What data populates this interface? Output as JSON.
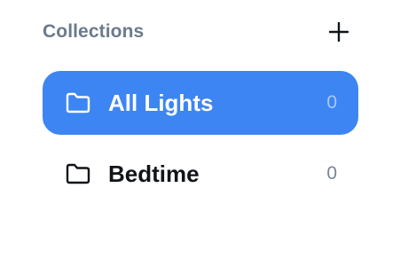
{
  "collections": {
    "title": "Collections",
    "add_icon": "plus-icon",
    "items": [
      {
        "label": "All Lights",
        "count": "0",
        "icon": "folder-icon",
        "active": true
      },
      {
        "label": "Bedtime",
        "count": "0",
        "icon": "folder-icon",
        "active": false
      }
    ]
  },
  "colors": {
    "accent": "#3d85f2",
    "header_text": "#6b7a8c",
    "item_text": "#111418",
    "count_text": "#7a8594"
  }
}
